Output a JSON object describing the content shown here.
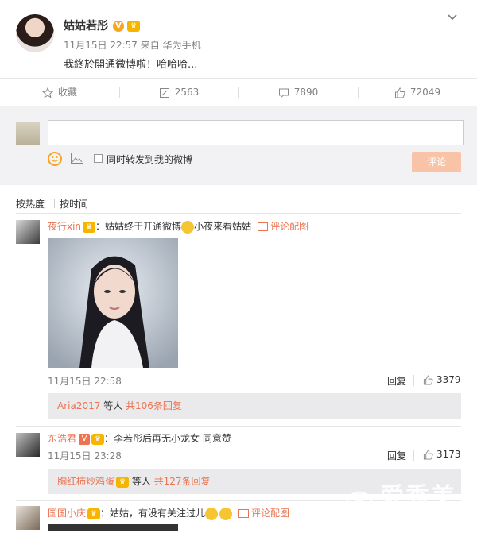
{
  "post": {
    "author": "姑姑若彤",
    "time": "11月15日 22:57",
    "source_prefix": "来自",
    "source": "华为手机",
    "text": "我終於開通微博啦！哈哈哈..."
  },
  "actions": {
    "favorite_label": "收藏",
    "repost_count": "2563",
    "comment_count": "7890",
    "like_count": "72049"
  },
  "compose": {
    "placeholder": "",
    "repost_checkbox_label": "同时转发到我的微博",
    "submit_label": "评论"
  },
  "sort": {
    "by_hot": "按热度",
    "by_time": "按时间"
  },
  "comments": [
    {
      "user": "夜行xin",
      "text_before_emoji": "：姑姑终于开通微博",
      "text_after_emoji": "小夜来看姑姑",
      "pic_link": "评论配图",
      "time": "11月15日 22:58",
      "reply_label": "回复",
      "likes": "3379",
      "sub": {
        "user": "Aria2017",
        "mid": " 等人 ",
        "count_link": "共106条回复"
      }
    },
    {
      "user": "东浩君",
      "text": "：李若彤后再无小龙女 同意赞",
      "time": "11月15日 23:28",
      "reply_label": "回复",
      "likes": "3173",
      "sub": {
        "user": "胸红柿炒鸡蛋",
        "mid": " 等人 ",
        "count_link": "共127条回复"
      }
    },
    {
      "user": "国国小庆",
      "text": "：姑姑，有没有关注过儿",
      "pic_link": "评论配图"
    }
  ],
  "watermark": {
    "brand": "爱秀美",
    "url": "ixiumei.com"
  },
  "colors": {
    "link": "#eb7350",
    "submit_bg": "#f9c3a8",
    "compose_bg": "#f2f2f5",
    "subreply_bg": "#eaeaec"
  }
}
